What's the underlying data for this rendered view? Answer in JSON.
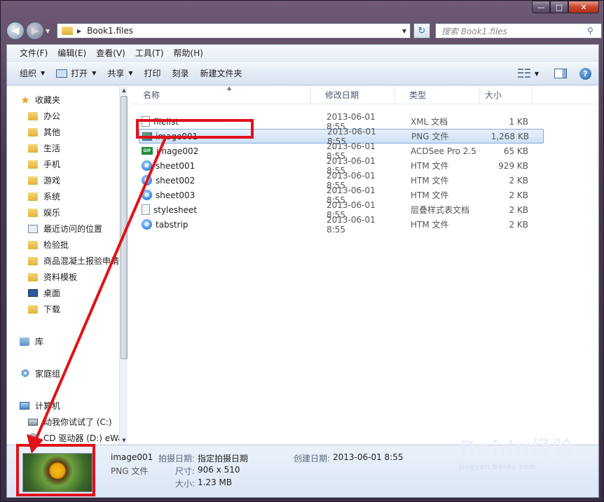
{
  "window": {
    "caption_min": "—",
    "caption_max": "□",
    "caption_close": "✕"
  },
  "navbar": {
    "back_icon": "◀",
    "forward_icon": "▶",
    "address_path": "Book1.files",
    "search_placeholder": "搜索 Book1.files",
    "refresh_icon": "↻",
    "search_icon": "⚲"
  },
  "menu": [
    "文件(F)",
    "编辑(E)",
    "查看(V)",
    "工具(T)",
    "帮助(H)"
  ],
  "toolbar": {
    "organize": "组织",
    "open": "打开",
    "share": "共享",
    "print": "打印",
    "burn": "刻录",
    "new_folder": "新建文件夹"
  },
  "sidebar": {
    "favorites": "收藏夹",
    "items": [
      "办公",
      "其他",
      "生活",
      "手机",
      "游戏",
      "系统",
      "娱乐",
      "最近访问的位置",
      "检验批",
      "商品混凝土报验申请",
      "资料模板",
      "桌面",
      "下载"
    ],
    "library": "库",
    "homegroup": "家庭组",
    "computer": "计算机",
    "drive_c": "动我你试试了 (C:)",
    "drive_d": "CD 驱动器 (D:) eWa"
  },
  "columns": {
    "name": "名称",
    "modified": "修改日期",
    "type": "类型",
    "size": "大小"
  },
  "files": [
    {
      "name": "filelist",
      "date": "2013-06-01 8:55",
      "type": "XML 文档",
      "size": "1 KB",
      "icon": "xml-icon"
    },
    {
      "name": "image001",
      "date": "2013-06-01 8:55",
      "type": "PNG 文件",
      "size": "1,268 KB",
      "icon": "png-icon"
    },
    {
      "name": "image002",
      "date": "2013-06-01 8:55",
      "type": "ACDSee Pro 2.5 ...",
      "size": "65 KB",
      "icon": "gif-icon"
    },
    {
      "name": "sheet001",
      "date": "2013-06-01 8:55",
      "type": "HTM 文件",
      "size": "929 KB",
      "icon": "ie-icon"
    },
    {
      "name": "sheet002",
      "date": "2013-06-01 8:55",
      "type": "HTM 文件",
      "size": "2 KB",
      "icon": "ie-icon"
    },
    {
      "name": "sheet003",
      "date": "2013-06-01 8:55",
      "type": "HTM 文件",
      "size": "2 KB",
      "icon": "ie-icon"
    },
    {
      "name": "stylesheet",
      "date": "2013-06-01 8:55",
      "type": "层叠样式表文档",
      "size": "2 KB",
      "icon": "css-icon"
    },
    {
      "name": "tabstrip",
      "date": "2013-06-01 8:55",
      "type": "HTM 文件",
      "size": "2 KB",
      "icon": "ie-icon"
    }
  ],
  "details": {
    "name": "image001",
    "type": "PNG 文件",
    "shot_date_label": "拍摄日期:",
    "shot_date_value": "指定拍摄日期",
    "dimensions_label": "尺寸:",
    "dimensions_value": "906 x 510",
    "size_label": "大小:",
    "size_value": "1.23 MB",
    "created_label": "创建日期:",
    "created_value": "2013-06-01 8:55"
  },
  "watermark": {
    "brand": "Baidu经验",
    "url": "jingyan.baidu.com"
  },
  "colors": {
    "annotation_red": "#e0121a",
    "selection_blue": "#cde0f5"
  }
}
